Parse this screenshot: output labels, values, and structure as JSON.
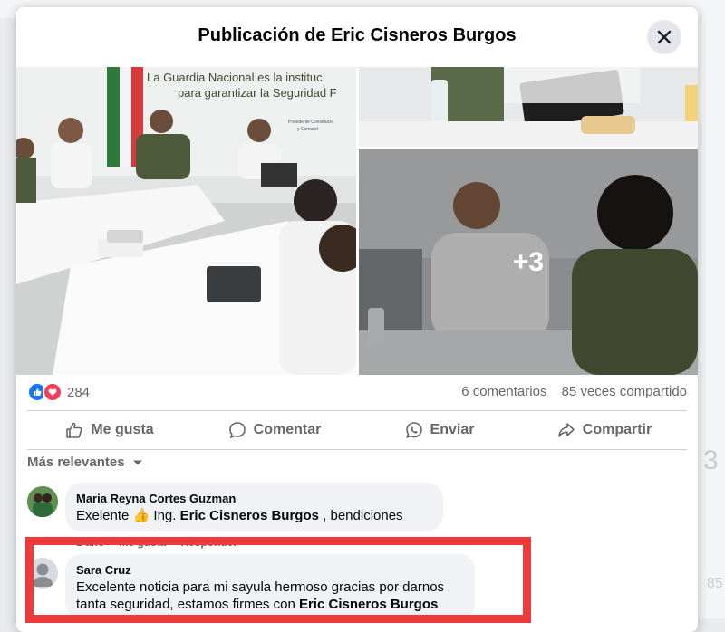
{
  "modal": {
    "title": "Publicación de Eric Cisneros Burgos",
    "close_icon": "close-icon"
  },
  "photos": {
    "banner_line1": "La Guardia Nacional es la instituc",
    "banner_line2": "para garantizar la Seguridad F",
    "banner_small1": "Presidente Constitucio",
    "banner_small2": "y Comand",
    "more_count": "+3"
  },
  "stats": {
    "reaction_icons": [
      "like-icon",
      "love-icon"
    ],
    "reaction_count": "284",
    "comments": "6 comentarios",
    "shares": "85 veces compartido"
  },
  "actions": {
    "like": "Me gusta",
    "comment": "Comentar",
    "send": "Enviar",
    "share": "Compartir"
  },
  "filter": {
    "label": "Más relevantes"
  },
  "comments": [
    {
      "author": "Maria Reyna Cortes Guzman",
      "text_before": "Exelente ",
      "emoji": "👍",
      "text_mid": " Ing. ",
      "mention": "Eric Cisneros Burgos",
      "text_after": " , bendiciones",
      "meta": {
        "time": "1 año",
        "like": "Me gusta",
        "reply": "Responder"
      }
    },
    {
      "author": "Sara Cruz",
      "text_before": "Excelente noticia para mi sayula hermoso gracias por darnos tanta seguridad, estamos firmes con ",
      "mention": "Eric Cisneros Burgos"
    }
  ],
  "background": {
    "side_number": "3",
    "side_number2": "85"
  },
  "colors": {
    "brand_blue": "#1877f2",
    "love_red": "#f33e58",
    "highlight_red": "#ee3b3b",
    "bubble_bg": "#f0f2f5"
  }
}
